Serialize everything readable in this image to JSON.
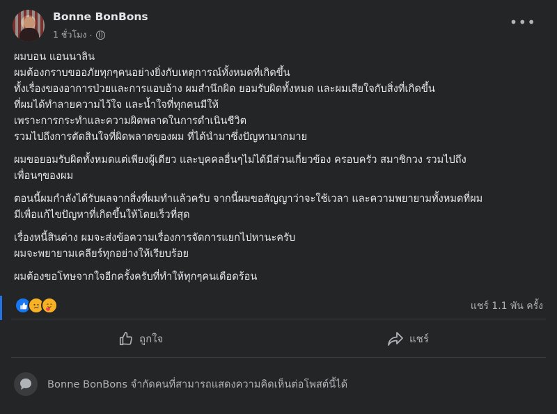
{
  "post": {
    "author": "Bonne BonBons",
    "time": "1 ชั่วโมง",
    "privacy_icon": "globe-icon",
    "more_icon": "more-options-icon",
    "paragraphs": [
      [
        "ผมบอน แอนนาลิน",
        "ผมต้องกราบขออภัยทุกๆคนอย่างยิ่งกับเหตุการณ์ทั้งหมดที่เกิดขึ้น",
        "ทั้งเรื่องของอาการป่วยและการแอบอ้าง ผมสำนึกผิด ยอมรับผิดทั้งหมด และผมเสียใจกับสิ่งที่เกิดขึ้น",
        "ที่ผมได้ทำลายความไว้ใจ และน้ำใจที่ทุกคนมีให้",
        "เพราะการกระทำและความผิดพลาดในการดำเนินชีวิต",
        "รวมไปถึงการตัดสินใจที่ผิดพลาดของผม ที่ได้นำมาซึ่งปัญหามากมาย"
      ],
      [
        "ผมขอยอมรับผิดทั้งหมดแต่เพียงผู้เดียว และบุคคลอื่นๆไม่ได้มีส่วนเกี่ยวข้อง ครอบครัว สมาชิกวง รวมไปถึง",
        "เพื่อนๆของผม"
      ],
      [
        "ตอนนี้ผมกำลังได้รับผลจากสิ่งที่ผมทำแล้วครับ จากนี้ผมขอสัญญาว่าจะใช้เวลา และความพยายามทั้งหมดที่ผม",
        "มีเพื่อแก้ไขปัญหาที่เกิดขึ้นให้โดยเร็วที่สุด"
      ],
      [
        "เรื่องหนี้สินต่าง ผมจะส่งข้อความเรื่องการจัดการแยกไปหานะครับ",
        "ผมจะพยายามเคลียร์ทุกอย่างให้เรียบร้อย"
      ],
      [
        "ผมต้องขอโทษจากใจอีกครั้งครับที่ทำให้ทุกๆคนเดือดร้อน"
      ]
    ]
  },
  "reactions": {
    "icons": [
      "like-reaction-icon",
      "sad-reaction-icon",
      "care-reaction-icon"
    ],
    "shares": "แชร์ 1.1 พัน ครั้ง"
  },
  "actions": {
    "like_label": "ถูกใจ",
    "share_label": "แชร์"
  },
  "comments": {
    "blocked_text": "Bonne BonBons จำกัดคนที่สามารถแสดงความคิดเห็นต่อโพสต์นี้ได้"
  },
  "colors": {
    "background": "#242526",
    "text": "#e4e6eb",
    "secondary_text": "#b0b3b8",
    "accent": "#1877f2"
  }
}
